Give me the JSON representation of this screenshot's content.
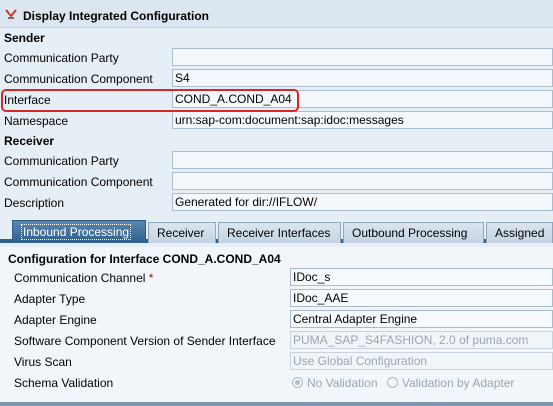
{
  "header": {
    "title": "Display Integrated Configuration"
  },
  "sender": {
    "heading": "Sender",
    "rows": [
      {
        "label": "Communication Party",
        "value": ""
      },
      {
        "label": "Communication Component",
        "value": "S4"
      },
      {
        "label": "Interface",
        "value": "COND_A.COND_A04"
      },
      {
        "label": "Namespace",
        "value": "urn:sap-com:document:sap:idoc:messages"
      }
    ]
  },
  "receiver": {
    "heading": "Receiver",
    "rows": [
      {
        "label": "Communication Party",
        "value": ""
      },
      {
        "label": "Communication Component",
        "value": ""
      },
      {
        "label": "Description",
        "value": "Generated for dir://IFLOW/"
      }
    ]
  },
  "tabs": [
    {
      "label": "Inbound Processing",
      "active": true
    },
    {
      "label": "Receiver"
    },
    {
      "label": "Receiver Interfaces"
    },
    {
      "label": "Outbound Processing"
    },
    {
      "label": "Assigned"
    }
  ],
  "config": {
    "title": "Configuration for Interface COND_A.COND_A04",
    "rows": [
      {
        "label": "Communication Channel",
        "required": "*",
        "value": "IDoc_s"
      },
      {
        "label": "Adapter Type",
        "value": "IDoc_AAE"
      },
      {
        "label": "Adapter Engine",
        "value": "Central Adapter Engine"
      },
      {
        "label": "Software Component Version of Sender Interface",
        "value": "PUMA_SAP_S4FASHION, 2.0 of puma.com"
      },
      {
        "label": "Virus Scan",
        "value": "Use Global Configuration"
      },
      {
        "label": "Schema Validation"
      }
    ],
    "schema_options": [
      "No Validation",
      "Validation by Adapter"
    ]
  },
  "colors": {
    "accent": "#2e5f8c",
    "highlight": "#d9262a"
  }
}
